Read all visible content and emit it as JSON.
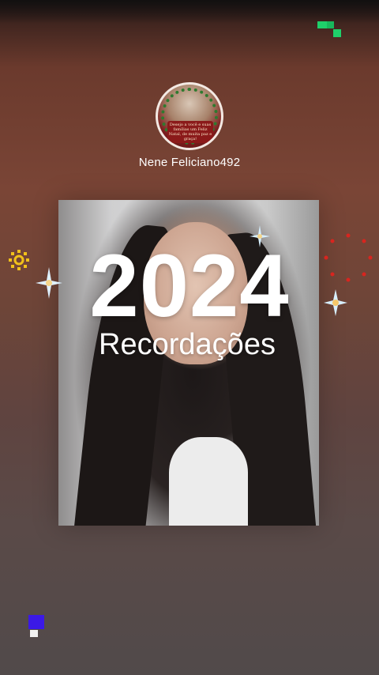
{
  "profile": {
    "username": "Nene Feliciano492",
    "avatar_card_text": "Desejo a você e suas famílias um Feliz Natal, de muita paz e graça!"
  },
  "memory": {
    "year": "2024",
    "title": "Recordações"
  },
  "decorations": {
    "icons": [
      "pixel-icon",
      "sun-icon",
      "sparkle-icon",
      "dotted-circle-icon"
    ],
    "colors": {
      "pixel_green": "#1fd06a",
      "pixel_blue": "#3b19e6",
      "sun_yellow": "#f2c21a",
      "red_dots": "#d8251f",
      "sparkle": "#cdeaff"
    }
  }
}
